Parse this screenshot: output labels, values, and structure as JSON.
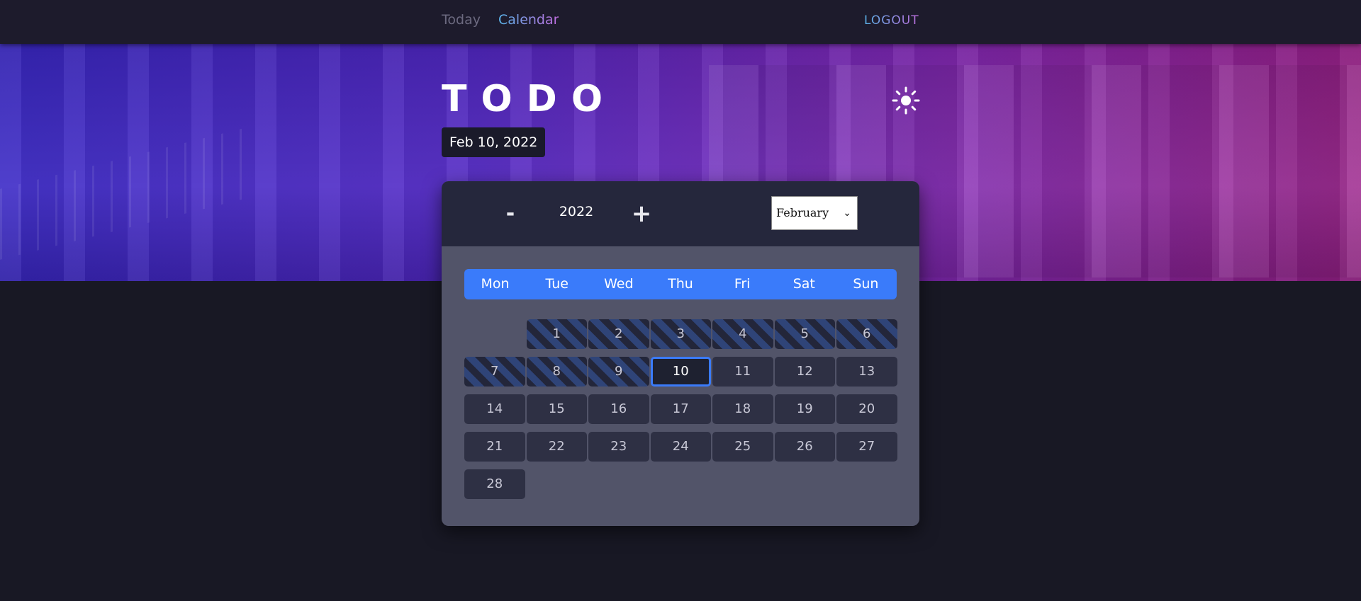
{
  "nav": {
    "today": "Today",
    "calendar": "Calendar",
    "logout": "LOGOUT"
  },
  "hero": {
    "title": "TODO",
    "date": "Feb 10, 2022",
    "theme_icon": "sun-icon"
  },
  "calendar": {
    "year_minus": "-",
    "year": "2022",
    "year_plus": "+",
    "month": "February",
    "weekdays": [
      "Mon",
      "Tue",
      "Wed",
      "Thu",
      "Fri",
      "Sat",
      "Sun"
    ],
    "days": [
      {
        "label": "",
        "state": "empty"
      },
      {
        "label": "1",
        "state": "past"
      },
      {
        "label": "2",
        "state": "past"
      },
      {
        "label": "3",
        "state": "past"
      },
      {
        "label": "4",
        "state": "past"
      },
      {
        "label": "5",
        "state": "past"
      },
      {
        "label": "6",
        "state": "past"
      },
      {
        "label": "7",
        "state": "past"
      },
      {
        "label": "8",
        "state": "past"
      },
      {
        "label": "9",
        "state": "past"
      },
      {
        "label": "10",
        "state": "today"
      },
      {
        "label": "11",
        "state": "future"
      },
      {
        "label": "12",
        "state": "future"
      },
      {
        "label": "13",
        "state": "future"
      },
      {
        "label": "14",
        "state": "future"
      },
      {
        "label": "15",
        "state": "future"
      },
      {
        "label": "16",
        "state": "future"
      },
      {
        "label": "17",
        "state": "future"
      },
      {
        "label": "18",
        "state": "future"
      },
      {
        "label": "19",
        "state": "future"
      },
      {
        "label": "20",
        "state": "future"
      },
      {
        "label": "21",
        "state": "future"
      },
      {
        "label": "22",
        "state": "future"
      },
      {
        "label": "23",
        "state": "future"
      },
      {
        "label": "24",
        "state": "future"
      },
      {
        "label": "25",
        "state": "future"
      },
      {
        "label": "26",
        "state": "future"
      },
      {
        "label": "27",
        "state": "future"
      },
      {
        "label": "28",
        "state": "future"
      }
    ]
  },
  "colors": {
    "accent": "#3a7bfa",
    "background": "#181824",
    "card": "#525469"
  }
}
